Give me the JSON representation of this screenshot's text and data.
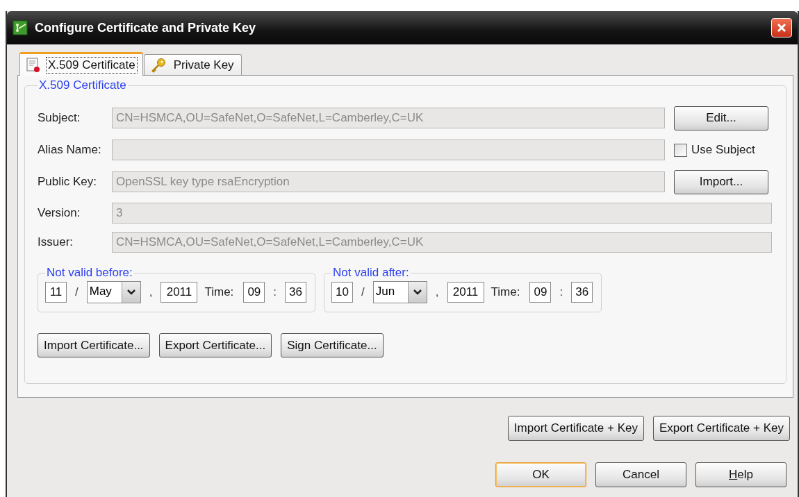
{
  "window": {
    "title": "Configure Certificate and Private Key"
  },
  "tabs": [
    {
      "label": "X.509 Certificate",
      "selected": true,
      "kind": "certificate"
    },
    {
      "label": "Private Key",
      "selected": false,
      "kind": "key"
    }
  ],
  "group": {
    "title": "X.509 Certificate"
  },
  "fields": [
    {
      "label": "Subject:",
      "value": "CN=HSMCA,OU=SafeNet,O=SafeNet,L=Camberley,C=UK",
      "action": "Edit..."
    },
    {
      "label": "Alias Name:",
      "checkbox": {
        "label": "Use Subject",
        "checked": false
      }
    },
    {
      "label": "Public Key:",
      "value": "OpenSSL key type rsaEncryption",
      "action": "Import..."
    },
    {
      "label": "Version:",
      "value": "3"
    },
    {
      "label": "Issuer:",
      "value": "CN=HSMCA,OU=SafeNet,O=SafeNet,L=Camberley,C=UK"
    }
  ],
  "validity": [
    {
      "title": "Not valid before:",
      "day": "11",
      "separator": "/",
      "month": "May",
      "comma": ",",
      "year": "2011",
      "time_label": "Time:",
      "hour": "09",
      "colon": ":",
      "minute": "36"
    },
    {
      "title": "Not valid after:",
      "day": "10",
      "separator": "/",
      "month": "Jun",
      "comma": ",",
      "year": "2011",
      "time_label": "Time:",
      "hour": "09",
      "colon": ":",
      "minute": "36"
    }
  ],
  "cert_buttons": [
    "Import Certificate...",
    "Export Certificate...",
    "Sign Certificate..."
  ],
  "key_buttons": [
    "Import Certificate + Key",
    "Export Certificate + Key"
  ],
  "dialog_buttons": [
    {
      "label": "OK",
      "default": true,
      "underline_first": false
    },
    {
      "label": "Cancel",
      "default": false,
      "underline_first": false
    },
    {
      "label": "Help",
      "default": false,
      "underline_first": true
    }
  ]
}
